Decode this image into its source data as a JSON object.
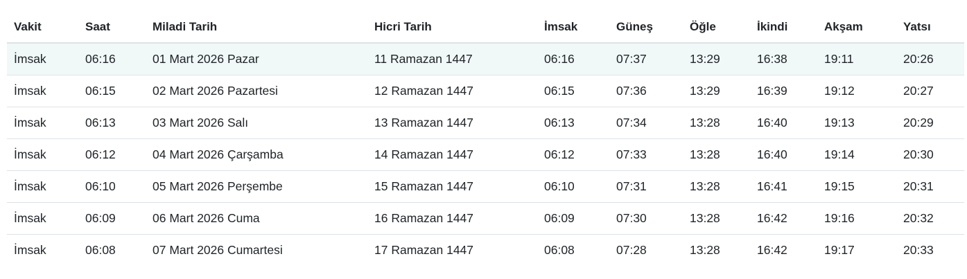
{
  "table": {
    "headers": [
      "Vakit",
      "Saat",
      "Miladi Tarih",
      "Hicri Tarih",
      "İmsak",
      "Güneş",
      "Öğle",
      "İkindi",
      "Akşam",
      "Yatsı"
    ],
    "rows": [
      [
        "İmsak",
        "06:16",
        "01 Mart 2026 Pazar",
        "11 Ramazan 1447",
        "06:16",
        "07:37",
        "13:29",
        "16:38",
        "19:11",
        "20:26"
      ],
      [
        "İmsak",
        "06:15",
        "02 Mart 2026 Pazartesi",
        "12 Ramazan 1447",
        "06:15",
        "07:36",
        "13:29",
        "16:39",
        "19:12",
        "20:27"
      ],
      [
        "İmsak",
        "06:13",
        "03 Mart 2026 Salı",
        "13 Ramazan 1447",
        "06:13",
        "07:34",
        "13:28",
        "16:40",
        "19:13",
        "20:29"
      ],
      [
        "İmsak",
        "06:12",
        "04 Mart 2026 Çarşamba",
        "14 Ramazan 1447",
        "06:12",
        "07:33",
        "13:28",
        "16:40",
        "19:14",
        "20:30"
      ],
      [
        "İmsak",
        "06:10",
        "05 Mart 2026 Perşembe",
        "15 Ramazan 1447",
        "06:10",
        "07:31",
        "13:28",
        "16:41",
        "19:15",
        "20:31"
      ],
      [
        "İmsak",
        "06:09",
        "06 Mart 2026 Cuma",
        "16 Ramazan 1447",
        "06:09",
        "07:30",
        "13:28",
        "16:42",
        "19:16",
        "20:32"
      ],
      [
        "İmsak",
        "06:08",
        "07 Mart 2026 Cumartesi",
        "17 Ramazan 1447",
        "06:08",
        "07:28",
        "13:28",
        "16:42",
        "19:17",
        "20:33"
      ]
    ]
  },
  "colors": {
    "highlight_row": "#f0f8f8",
    "border": "#dee2e6",
    "text": "#212529"
  }
}
